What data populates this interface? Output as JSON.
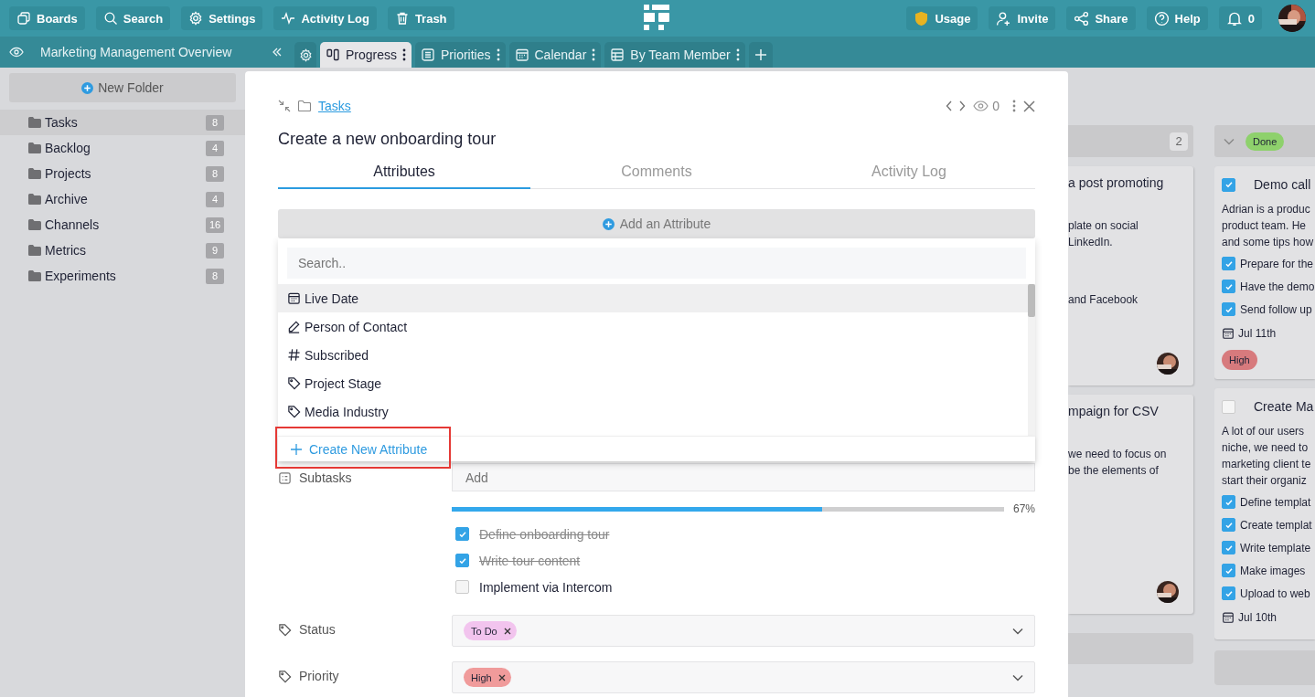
{
  "top_bar": {
    "left_buttons": [
      {
        "label": "Boards"
      },
      {
        "label": "Search"
      },
      {
        "label": "Settings"
      },
      {
        "label": "Activity Log"
      },
      {
        "label": "Trash"
      }
    ],
    "right_buttons": [
      {
        "label": "Usage"
      },
      {
        "label": "Invite"
      },
      {
        "label": "Share"
      },
      {
        "label": "Help"
      }
    ],
    "notifications": "0"
  },
  "board_bar": {
    "title": "Marketing Management Overview",
    "views": [
      {
        "label": "Progress",
        "kind": "kanban",
        "selected": true
      },
      {
        "label": "Priorities",
        "kind": "list",
        "selected": false
      },
      {
        "label": "Calendar",
        "kind": "calendar",
        "selected": false
      },
      {
        "label": "By Team Member",
        "kind": "table",
        "selected": false
      }
    ]
  },
  "sidebar": {
    "new_folder": "New Folder",
    "folders": [
      {
        "name": "Tasks",
        "count": "8",
        "selected": true
      },
      {
        "name": "Backlog",
        "count": "4",
        "selected": false
      },
      {
        "name": "Projects",
        "count": "8",
        "selected": false
      },
      {
        "name": "Archive",
        "count": "4",
        "selected": false
      },
      {
        "name": "Channels",
        "count": "16",
        "selected": false
      },
      {
        "name": "Metrics",
        "count": "9",
        "selected": false
      },
      {
        "name": "Experiments",
        "count": "8",
        "selected": false
      }
    ]
  },
  "modal": {
    "breadcrumb": "Tasks",
    "watchers": "0",
    "title": "Create a new onboarding tour",
    "tabs": [
      {
        "label": "Attributes",
        "selected": true
      },
      {
        "label": "Comments",
        "selected": false
      },
      {
        "label": "Activity Log",
        "selected": false
      }
    ],
    "add_attribute": "Add an Attribute",
    "attribute_menu": {
      "search_placeholder": "Search..",
      "items": [
        {
          "label": "Live Date",
          "kind": "date",
          "selected": true
        },
        {
          "label": "Person of Contact",
          "kind": "text",
          "selected": false
        },
        {
          "label": "Subscribed",
          "kind": "number",
          "selected": false
        },
        {
          "label": "Project Stage",
          "kind": "label",
          "selected": false
        },
        {
          "label": "Media Industry",
          "kind": "label",
          "selected": false
        }
      ],
      "create": "Create New Attribute",
      "highlighted": true
    },
    "subtasks": {
      "label": "Subtasks",
      "placeholder": "Add",
      "level": 0.67,
      "percent": "67%",
      "items": [
        {
          "text": "Define onboarding tour",
          "checked": true
        },
        {
          "text": "Write tour content",
          "checked": true
        },
        {
          "text": "Implement via Intercom",
          "checked": false
        }
      ]
    },
    "fields": [
      {
        "label": "Status",
        "tags": [
          {
            "text": "To Do",
            "color": "#f2c4ee"
          }
        ]
      },
      {
        "label": "Priority",
        "tags": [
          {
            "text": "High",
            "color": "#f09b9b"
          }
        ]
      }
    ]
  },
  "board": {
    "partial_column": {
      "count": "2",
      "cards": [
        {
          "title": "a post promoting",
          "lines": [
            "plate on social",
            "LinkedIn."
          ],
          "extra": "and Facebook"
        },
        {
          "title": "mpaign for CSV",
          "lines": [
            "we need to focus on",
            "be the elements of"
          ]
        }
      ]
    },
    "done_column": {
      "status": "Done",
      "cards": [
        {
          "title": "Demo call",
          "checked": true,
          "lines": [
            "Adrian is a produc",
            "product team. He",
            "and some tips how"
          ],
          "checks": [
            {
              "text": "Prepare for the",
              "checked": true
            },
            {
              "text": "Have the demo",
              "checked": true
            },
            {
              "text": "Send follow up",
              "checked": true
            }
          ],
          "date": "Jul 11th",
          "priority": {
            "text": "High",
            "color": "#d77a7d"
          }
        },
        {
          "title": "Create Ma",
          "checked": false,
          "lines": [
            "A lot of our users",
            "niche, we need to",
            "marketing client te",
            "start their organiz"
          ],
          "checks": [
            {
              "text": "Define templat",
              "checked": true
            },
            {
              "text": "Create templat",
              "checked": true
            },
            {
              "text": "Write template",
              "checked": true
            },
            {
              "text": "Make images",
              "checked": true
            },
            {
              "text": "Upload to web",
              "checked": true
            }
          ],
          "date": "Jul 10th"
        }
      ]
    }
  }
}
